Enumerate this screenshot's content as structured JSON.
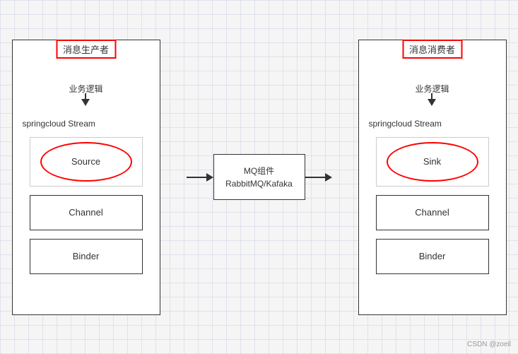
{
  "producer": {
    "title": "消息生产者",
    "subtitle": "业务逻辑",
    "stream_label": "springcloud Stream",
    "source_label": "Source",
    "channel_label": "Channel",
    "binder_label": "Binder"
  },
  "consumer": {
    "title": "消息消费者",
    "subtitle": "业务逻辑",
    "stream_label": "springcloud Stream",
    "sink_label": "Sink",
    "channel_label": "Channel",
    "binder_label": "Binder"
  },
  "mq": {
    "line1": "MQ组件",
    "line2": "RabbitMQ/Kafaka"
  },
  "watermark": "CSDN @zoeil",
  "colors": {
    "red": "#e00",
    "border": "#333",
    "bg": "#fff"
  }
}
